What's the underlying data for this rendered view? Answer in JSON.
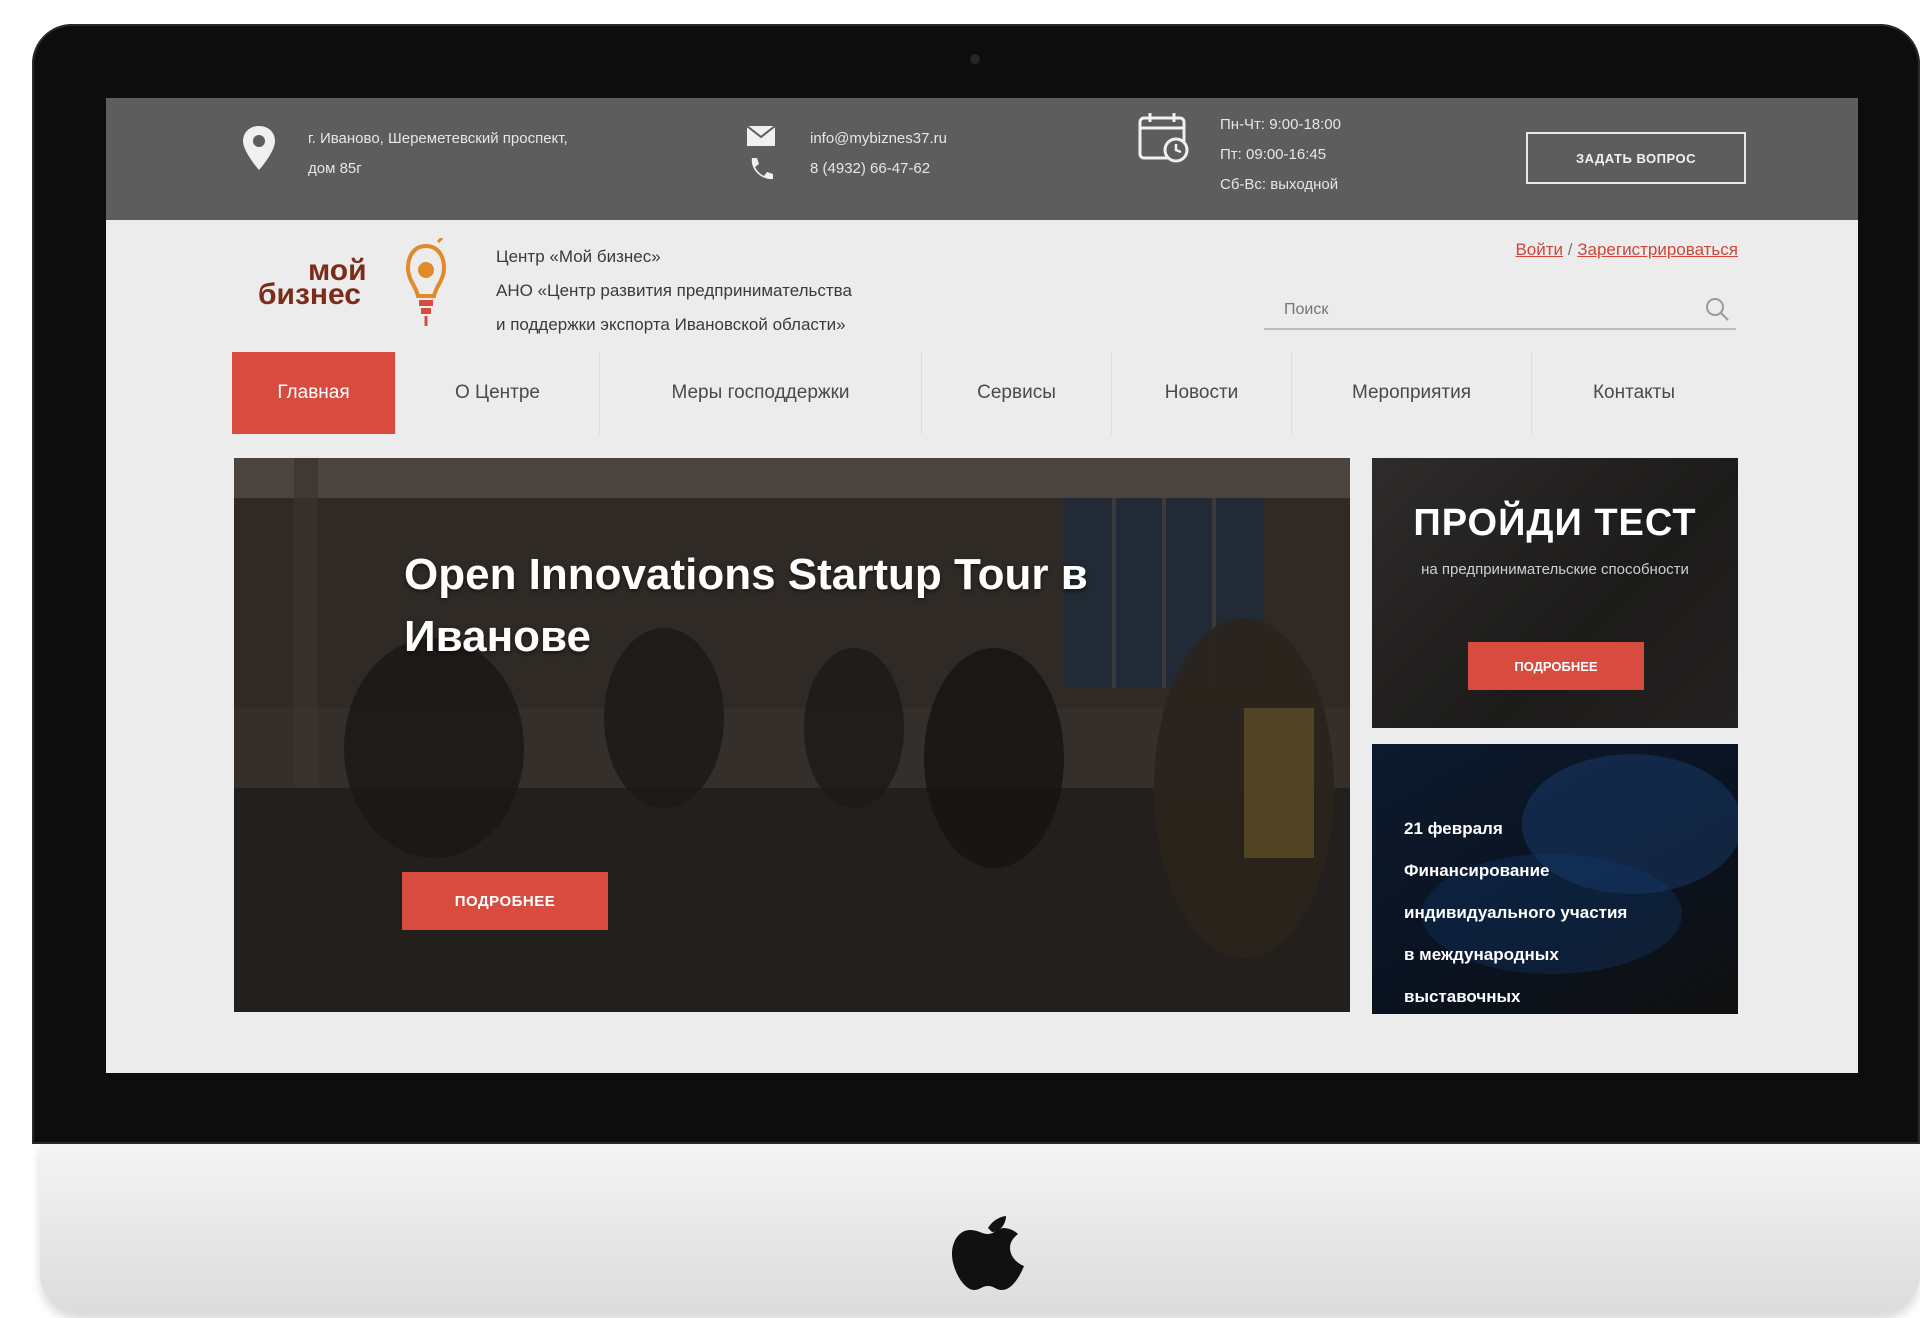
{
  "topbar": {
    "address_line1": "г. Иваново, Шереметевский проспект,",
    "address_line2": "дом 85г",
    "email": "info@mybiznes37.ru",
    "phone": "8 (4932) 66-47-62",
    "hours": [
      "Пн-Чт: 9:00-18:00",
      "Пт: 09:00-16:45",
      "Сб-Вс: выходной"
    ],
    "ask_button": "ЗАДАТЬ ВОПРОС"
  },
  "header": {
    "logo_word1": "мой",
    "logo_word2": "бизнес",
    "org_lines": [
      "Центр «Мой бизнес»",
      "АНО «Центр развития предпринимательства",
      "и поддержки экспорта Ивановской области»"
    ],
    "login": "Войти",
    "separator": "/",
    "register": "Зарегистрироваться",
    "search_placeholder": "Поиск"
  },
  "nav": {
    "items": [
      {
        "label": "Главная",
        "active": true
      },
      {
        "label": "О Центре",
        "active": false
      },
      {
        "label": "Меры господдержки",
        "active": false
      },
      {
        "label": "Сервисы",
        "active": false
      },
      {
        "label": "Новости",
        "active": false
      },
      {
        "label": "Мероприятия",
        "active": false
      },
      {
        "label": "Контакты",
        "active": false
      }
    ]
  },
  "hero": {
    "title": "Open Innovations Startup Tour в Иванове",
    "button": "ПОДРОБНЕЕ"
  },
  "card_test": {
    "title": "ПРОЙДИ ТЕСТ",
    "subtitle": "на предпринимательские способности",
    "button": "ПОДРОБНЕЕ"
  },
  "card_event": {
    "lines": [
      "21 февраля",
      "Финансирование",
      "индивидуального участия",
      "в международных",
      "выставочных"
    ]
  },
  "colors": {
    "accent": "#d74c3f",
    "topbar": "#5d5d5d",
    "screen_bg": "#ececec"
  }
}
